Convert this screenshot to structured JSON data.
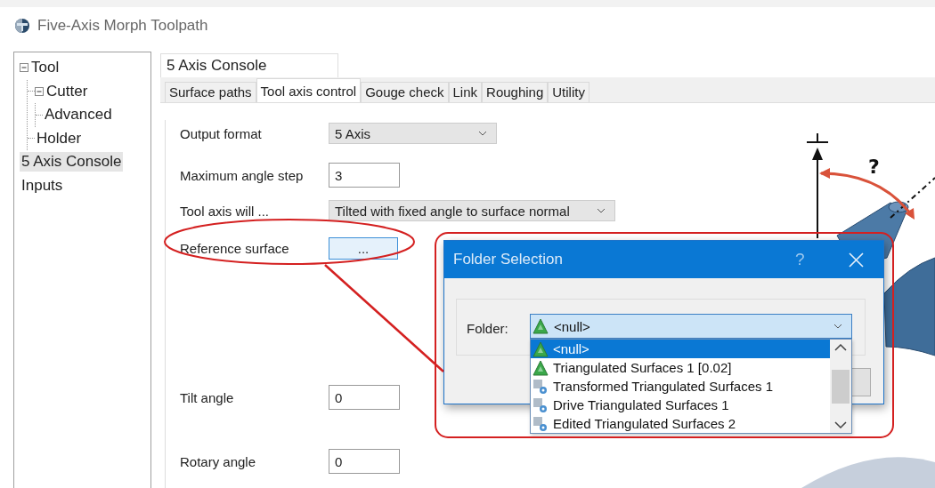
{
  "window": {
    "title": "Five-Axis Morph Toolpath"
  },
  "tree": [
    {
      "label": "Tool",
      "expanded": true,
      "selected": false,
      "children": [
        {
          "label": "Cutter",
          "expanded": true,
          "selected": false,
          "children": [
            {
              "label": "Advanced",
              "selected": false
            }
          ]
        },
        {
          "label": "Holder",
          "selected": false
        }
      ]
    },
    {
      "label": "5 Axis Console",
      "selected": true
    },
    {
      "label": "Inputs",
      "selected": false
    }
  ],
  "page": {
    "title": "5 Axis Console"
  },
  "tabs": [
    {
      "label": "Surface paths",
      "selected": false
    },
    {
      "label": "Tool axis control",
      "selected": true
    },
    {
      "label": "Gouge check",
      "selected": false
    },
    {
      "label": "Link",
      "selected": false
    },
    {
      "label": "Roughing",
      "selected": false
    },
    {
      "label": "Utility",
      "selected": false
    }
  ],
  "form": [
    {
      "kind": "dropdown",
      "label": "Output format",
      "value": "5 Axis"
    },
    {
      "kind": "input",
      "label": "Maximum angle step",
      "value": "3"
    },
    {
      "kind": "dropdown",
      "label": "Tool axis will ...",
      "value": "Tilted with fixed angle to surface normal"
    },
    {
      "kind": "button",
      "label": "Reference surface",
      "value": "..."
    },
    {
      "kind": "input",
      "label": "Tilt angle",
      "value": "0"
    },
    {
      "kind": "input",
      "label": "Rotary angle",
      "value": "0"
    }
  ],
  "diagram": {
    "angle_label": "?"
  },
  "dialog": {
    "title": "Folder Selection",
    "help": "?",
    "folder_label": "Folder:",
    "folder_value": "<null>",
    "options": [
      {
        "label": "<null>",
        "kind": "triangulated",
        "selected": true
      },
      {
        "label": "Triangulated Surfaces 1 [0.02]",
        "kind": "triangulated",
        "selected": false
      },
      {
        "label": "Transformed Triangulated Surfaces 1",
        "kind": "derived",
        "selected": false
      },
      {
        "label": "Drive Triangulated Surfaces 1",
        "kind": "derived",
        "selected": false
      },
      {
        "label": "Edited Triangulated Surfaces 2",
        "kind": "derived",
        "selected": false
      }
    ]
  }
}
